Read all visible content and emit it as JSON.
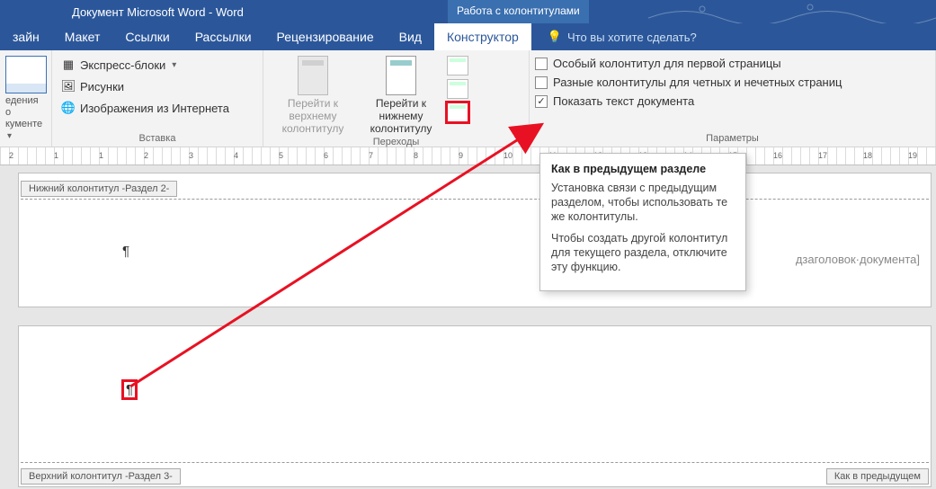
{
  "title": "Документ Microsoft Word - Word",
  "context_tab": "Работа с колонтитулами",
  "tabs": {
    "design": "зайн",
    "layout": "Макет",
    "references": "Ссылки",
    "mailings": "Рассылки",
    "review": "Рецензирование",
    "view": "Вид",
    "constructor": "Конструктор"
  },
  "tell_me": "Что вы хотите сделать?",
  "ribbon": {
    "doc_info": {
      "line1": "едения о",
      "line2": "кументе",
      "group": ""
    },
    "insert": {
      "quick_parts": "Экспресс-блоки",
      "pictures": "Рисунки",
      "online_pictures": "Изображения из Интернета",
      "group": "Вставка"
    },
    "nav": {
      "goto_header": "Перейти к верхнему колонтитулу",
      "goto_footer": "Перейти к нижнему колонтитулу",
      "group": "Переходы"
    },
    "params": {
      "first_page": "Особый колонтитул для первой страницы",
      "odd_even": "Разные колонтитулы для четных и нечетных страниц",
      "show_doc": "Показать текст документа",
      "group": "Параметры"
    }
  },
  "ruler_numbers": [
    "2",
    "1",
    "1",
    "2",
    "3",
    "4",
    "5",
    "6",
    "7",
    "8",
    "9",
    "10",
    "11",
    "12",
    "13",
    "14",
    "15",
    "16",
    "17",
    "18",
    "19"
  ],
  "doc": {
    "footer_tag": "Нижний колонтитул -Раздел 2-",
    "header_tag": "Верхний колонтитул -Раздел 3-",
    "same_prev": "Как в предыдущем",
    "pilcrow": "¶",
    "subtitle": "дзаголовок·документа]"
  },
  "tooltip": {
    "title": "Как в предыдущем разделе",
    "p1": "Установка связи с предыдущим разделом, чтобы использовать те же колонтитулы.",
    "p2": "Чтобы создать другой колонтитул для текущего раздела, отключите эту функцию."
  }
}
